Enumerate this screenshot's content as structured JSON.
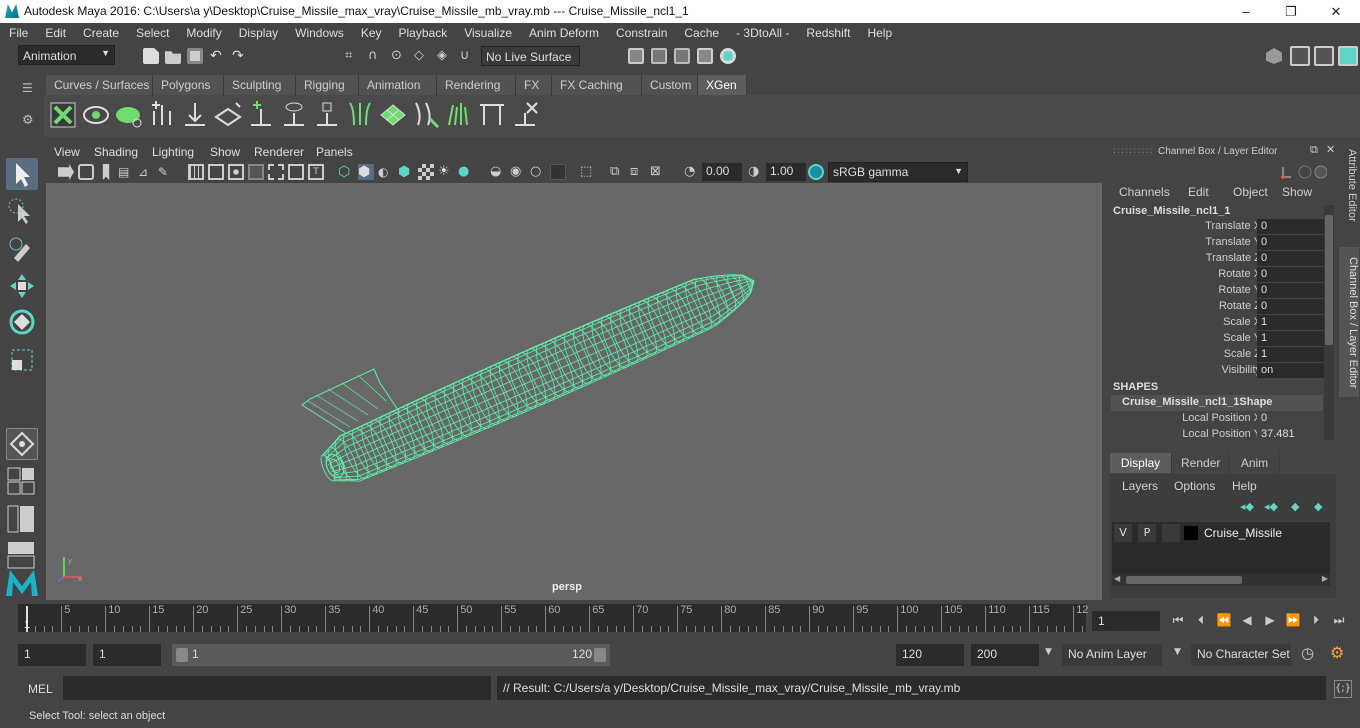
{
  "window": {
    "title": "Autodesk Maya 2016: C:\\Users\\a y\\Desktop\\Cruise_Missile_max_vray\\Cruise_Missile_mb_vray.mb   ---   Cruise_Missile_ncl1_1",
    "minimize": "–",
    "maximize": "❐",
    "close": "✕"
  },
  "menu": [
    "File",
    "Edit",
    "Create",
    "Select",
    "Modify",
    "Display",
    "Windows",
    "Key",
    "Playback",
    "Visualize",
    "Anim Deform",
    "Constrain",
    "Cache",
    "- 3DtoAll -",
    "Redshift",
    "Help"
  ],
  "status": {
    "mode": "Animation",
    "live_surface": "No Live Surface"
  },
  "shelf_tabs": [
    "Curves / Surfaces",
    "Polygons",
    "Sculpting",
    "Rigging",
    "Animation",
    "Rendering",
    "FX",
    "FX Caching",
    "Custom",
    "XGen"
  ],
  "shelf_active": "XGen",
  "viewport": {
    "menus": [
      "View",
      "Shading",
      "Lighting",
      "Show",
      "Renderer",
      "Panels"
    ],
    "exposure": "0.00",
    "gamma": "1.00",
    "colorspace": "sRGB gamma",
    "camera": "persp"
  },
  "channel_box": {
    "title": "Channel Box / Layer Editor",
    "menus": [
      "Channels",
      "Edit",
      "Object",
      "Show"
    ],
    "object": "Cruise_Missile_ncl1_1",
    "attrs": [
      {
        "label": "Translate X",
        "value": "0"
      },
      {
        "label": "Translate Y",
        "value": "0"
      },
      {
        "label": "Translate Z",
        "value": "0"
      },
      {
        "label": "Rotate X",
        "value": "0"
      },
      {
        "label": "Rotate Y",
        "value": "0"
      },
      {
        "label": "Rotate Z",
        "value": "0"
      },
      {
        "label": "Scale X",
        "value": "1"
      },
      {
        "label": "Scale Y",
        "value": "1"
      },
      {
        "label": "Scale Z",
        "value": "1"
      },
      {
        "label": "Visibility",
        "value": "on"
      }
    ],
    "shapes_header": "SHAPES",
    "shape_name": "Cruise_Missile_ncl1_1Shape",
    "shape_attrs": [
      {
        "label": "Local Position X",
        "value": "0"
      },
      {
        "label": "Local Position Y",
        "value": "37.481"
      }
    ]
  },
  "layer_editor": {
    "tabs": [
      "Display",
      "Render",
      "Anim"
    ],
    "active_tab": "Display",
    "menus": [
      "Layers",
      "Options",
      "Help"
    ],
    "layer": {
      "v": "V",
      "p": "P",
      "name": "Cruise_Missile"
    }
  },
  "side_tabs": [
    "Attribute Editor",
    "Channel Box / Layer Editor"
  ],
  "timeline": {
    "ticks": [
      "5",
      "10",
      "15",
      "20",
      "25",
      "30",
      "35",
      "40",
      "45",
      "50",
      "55",
      "60",
      "65",
      "70",
      "75",
      "80",
      "85",
      "90",
      "95",
      "100",
      "105",
      "110",
      "115",
      "12"
    ],
    "start_marker": "1",
    "current_frame": "1"
  },
  "range": {
    "start": "1",
    "playback_start": "1",
    "slider_start": "1",
    "slider_end": "120",
    "playback_end": "120",
    "end": "200",
    "anim_layer": "No Anim Layer",
    "char_set": "No Character Set"
  },
  "command": {
    "label": "MEL",
    "result": "// Result: C:/Users/a y/Desktop/Cruise_Missile_max_vray/Cruise_Missile_mb_vray.mb"
  },
  "help_line": "Select Tool: select an object",
  "colors": {
    "accent": "#5fd3c4",
    "wireframe": "#5cf0a8",
    "viewport_bg": "#686868"
  }
}
